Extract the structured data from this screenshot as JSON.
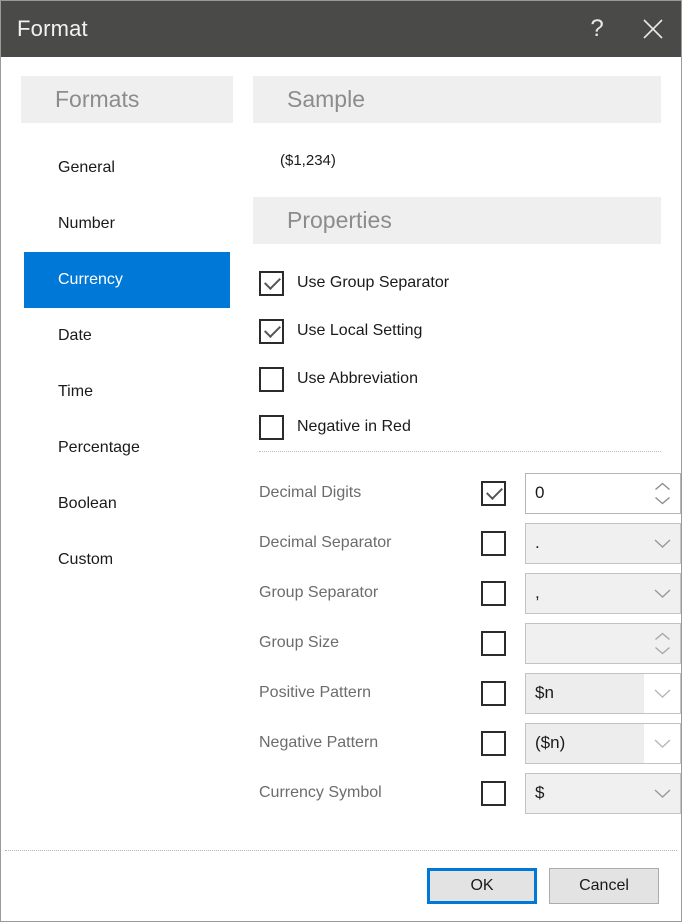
{
  "window": {
    "title": "Format",
    "help_icon": "question-mark-icon",
    "close_icon": "close-x-icon",
    "titlebar_color": "#4a4a48",
    "accent_color": "#0078d7"
  },
  "formats_panel": {
    "header": "Formats",
    "selected": "Currency",
    "items": [
      {
        "label": "General",
        "selected": false
      },
      {
        "label": "Number",
        "selected": false
      },
      {
        "label": "Currency",
        "selected": true
      },
      {
        "label": "Date",
        "selected": false
      },
      {
        "label": "Time",
        "selected": false
      },
      {
        "label": "Percentage",
        "selected": false
      },
      {
        "label": "Boolean",
        "selected": false
      },
      {
        "label": "Custom",
        "selected": false
      }
    ]
  },
  "sample": {
    "header": "Sample",
    "value": "($1,234)"
  },
  "properties": {
    "header": "Properties",
    "checkboxes": [
      {
        "label": "Use Group Separator",
        "checked": true
      },
      {
        "label": "Use Local Setting",
        "checked": true
      },
      {
        "label": "Use Abbreviation",
        "checked": false
      },
      {
        "label": "Negative in Red",
        "checked": false
      }
    ],
    "fields": [
      {
        "label": "Decimal Digits",
        "checked": true,
        "value": "0",
        "control": "spinner",
        "enabled": true
      },
      {
        "label": "Decimal Separator",
        "checked": false,
        "value": ".",
        "control": "dropdown",
        "enabled": false
      },
      {
        "label": "Group Separator",
        "checked": false,
        "value": ",",
        "control": "dropdown",
        "enabled": false
      },
      {
        "label": "Group Size",
        "checked": false,
        "value": "",
        "control": "spinner",
        "enabled": false
      },
      {
        "label": "Positive Pattern",
        "checked": false,
        "value": "$n",
        "control": "pattern",
        "enabled": false
      },
      {
        "label": "Negative Pattern",
        "checked": false,
        "value": "($n)",
        "control": "pattern",
        "enabled": false
      },
      {
        "label": "Currency Symbol",
        "checked": false,
        "value": "$",
        "control": "dropdown",
        "enabled": false
      }
    ]
  },
  "footer": {
    "ok_label": "OK",
    "cancel_label": "Cancel"
  }
}
